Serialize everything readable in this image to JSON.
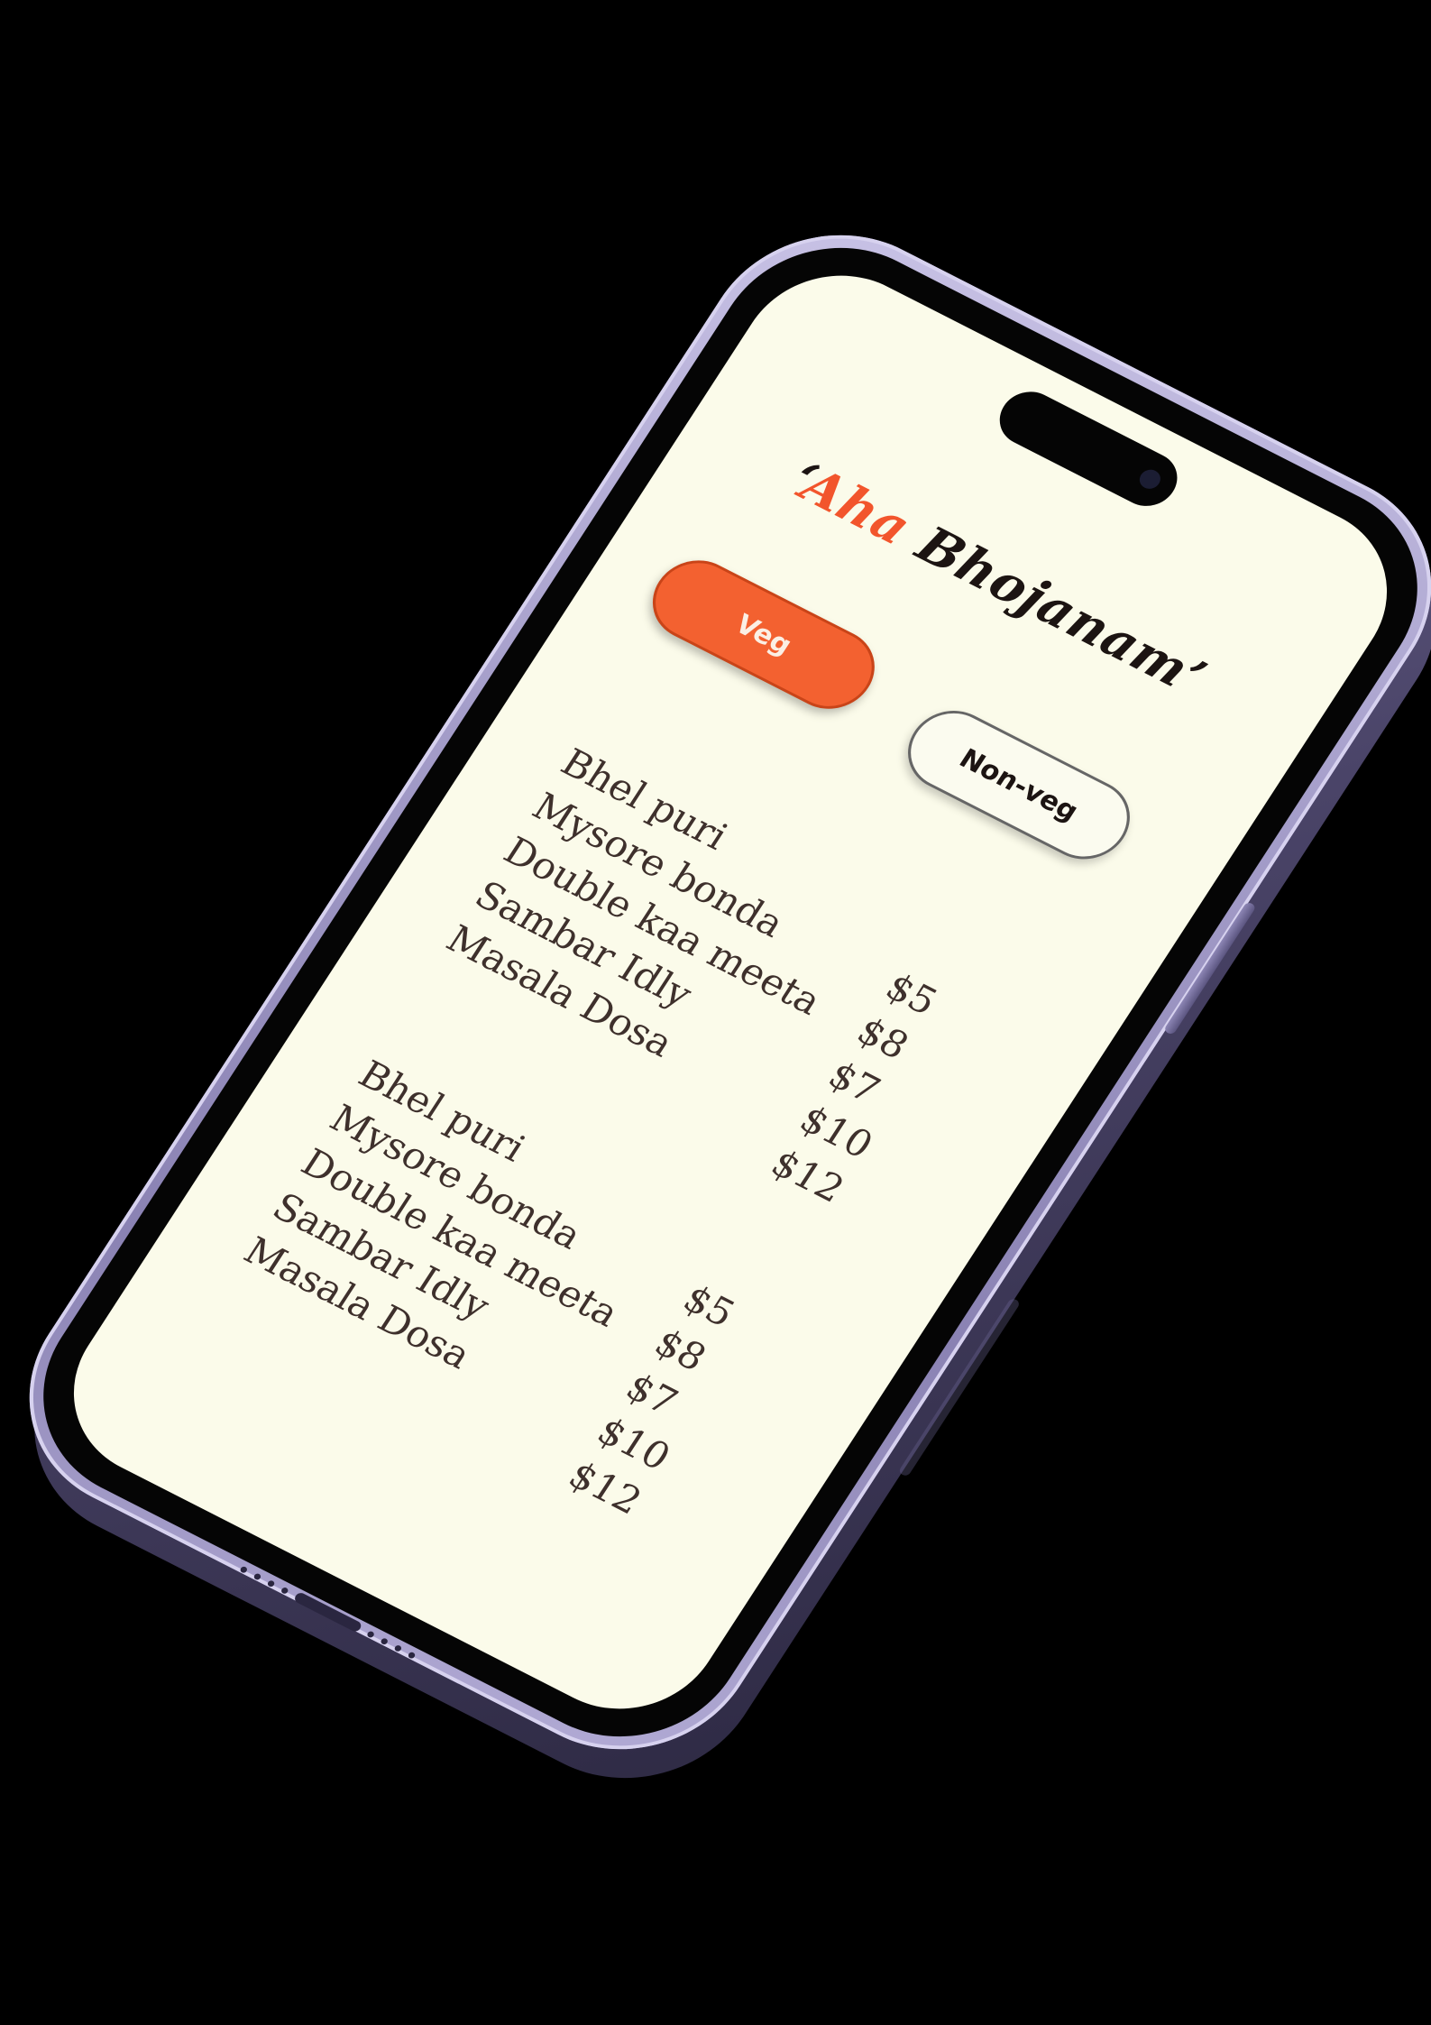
{
  "app": {
    "title_open_quote": "‘",
    "title_accent": "Aha",
    "title_rest": " Bhojanam",
    "title_close_quote": "’"
  },
  "filters": {
    "veg_label": "Veg",
    "nonveg_label": "Non-veg",
    "selected": "Veg"
  },
  "menu_sections": [
    {
      "names": [
        "Bhel puri",
        "Mysore bonda",
        "Double kaa meeta",
        "Sambar Idly",
        "Masala Dosa"
      ],
      "prices": [
        "$5",
        "$8",
        "$7",
        "$10",
        "$12"
      ]
    },
    {
      "names": [
        "Bhel puri",
        "Mysore bonda",
        "Double kaa meeta",
        "Sambar Idly",
        "Masala Dosa"
      ],
      "prices": [
        "$5",
        "$8",
        "$7",
        "$10",
        "$12"
      ]
    }
  ],
  "colors": {
    "accent": "#f36130",
    "screen_bg": "#fbfbea",
    "frame": "#a49dc9",
    "text": "#3e302c"
  },
  "icons": {
    "dynamic_island": "dynamic-island-icon",
    "camera": "camera-lens-icon"
  }
}
